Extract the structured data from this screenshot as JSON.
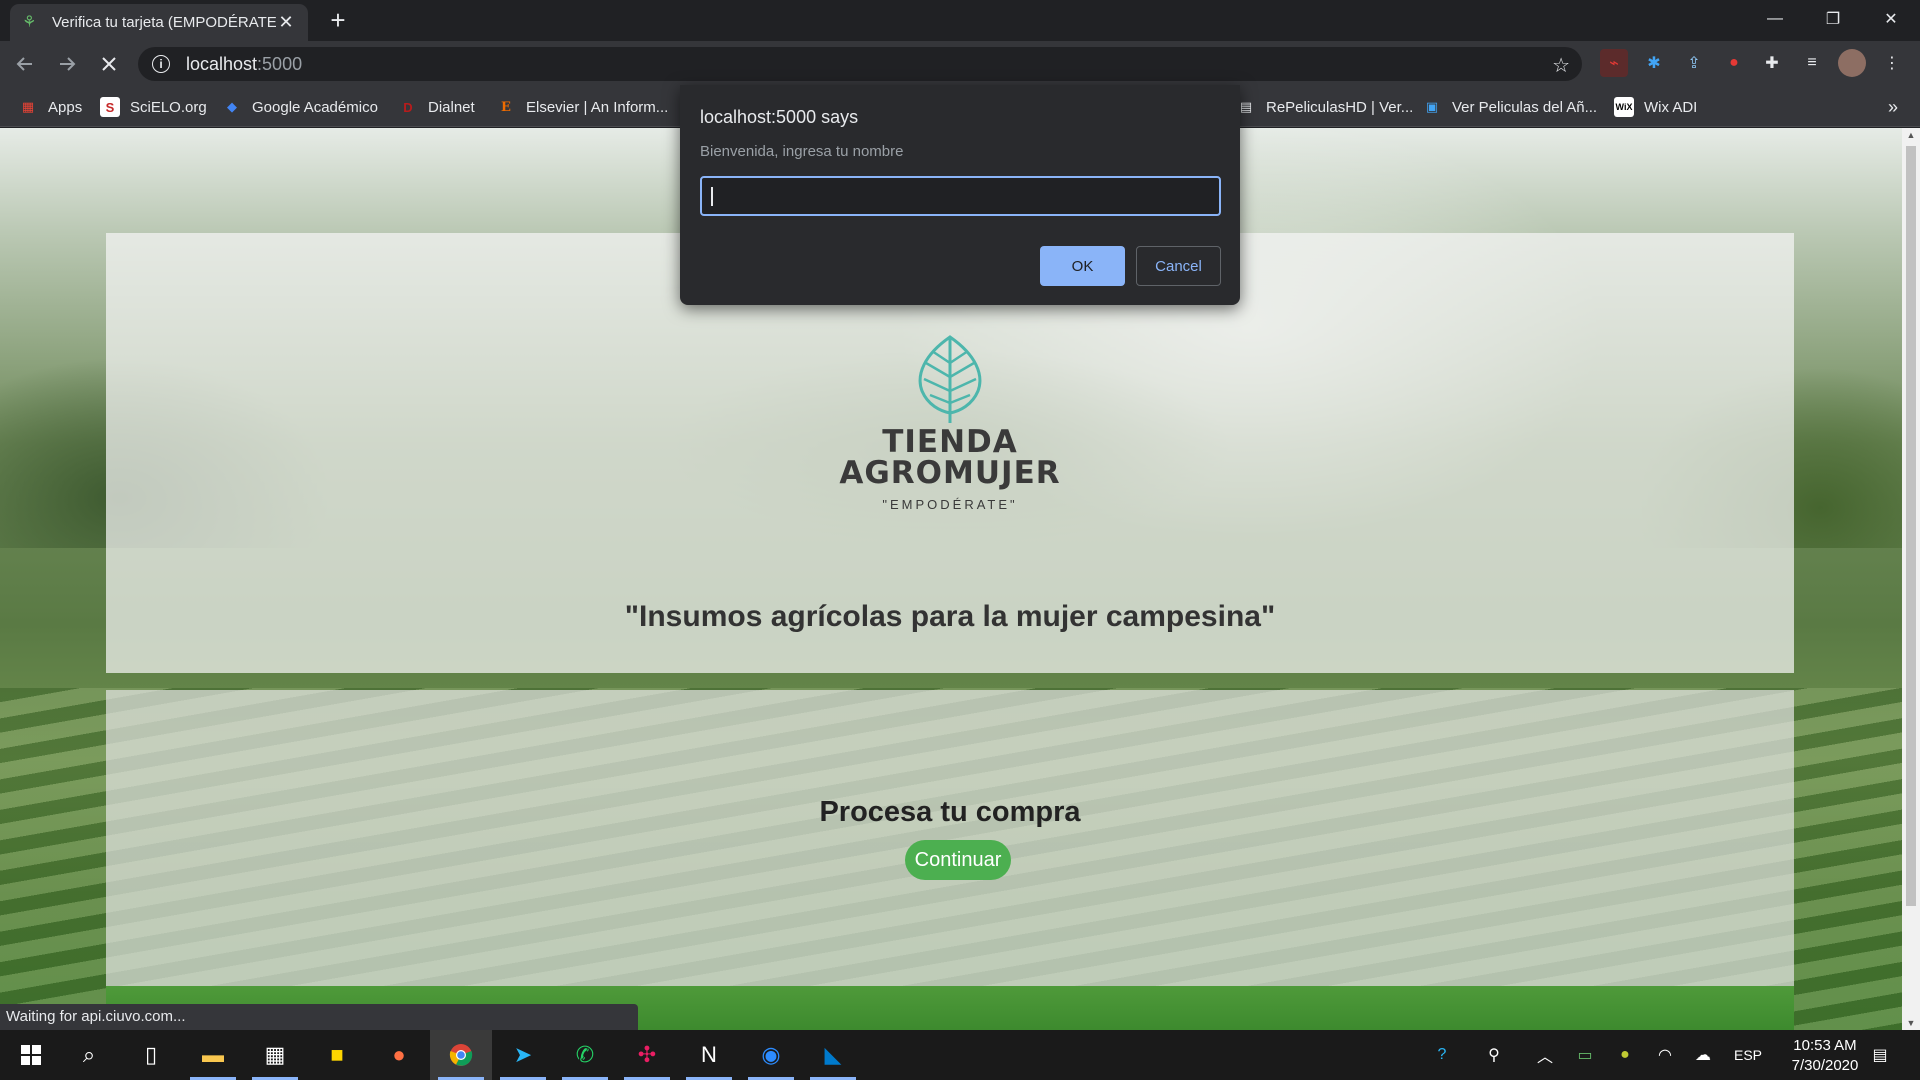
{
  "browser": {
    "tab_title": "Verifica tu tarjeta (EMPODÉRATE)",
    "tab_close": "✕",
    "new_tab": "+",
    "url_host": "localhost",
    "url_port": ":5000",
    "window_controls": {
      "minimize": "—",
      "restore": "❐",
      "close": "✕"
    },
    "bookmarks": [
      {
        "label": "Apps",
        "icon": "apps-grid-icon",
        "color": "#ea4335"
      },
      {
        "label": "SciELO.org",
        "icon": "scielo-icon",
        "color": "#c62828"
      },
      {
        "label": "Google Académico",
        "icon": "google-scholar-icon",
        "color": "#4285f4"
      },
      {
        "label": "Dialnet",
        "icon": "dialnet-icon",
        "color": "#b71c1c"
      },
      {
        "label": "Elsevier | An Inform...",
        "icon": "elsevier-icon",
        "color": "#ef6c00"
      },
      {
        "label": "RePeliculasHD | Ver...",
        "icon": "repeliculas-icon",
        "color": "#e8eaed"
      },
      {
        "label": "Ver Peliculas del Añ...",
        "icon": "peliculas-icon",
        "color": "#42a5f5"
      },
      {
        "label": "Wix ADI",
        "icon": "wix-icon",
        "color": "#ffffff"
      }
    ],
    "status_text": "Waiting for api.ciuvo.com..."
  },
  "dialog": {
    "title": "localhost:5000 says",
    "message": "Bienvenida, ingresa tu nombre",
    "input_value": "",
    "ok_label": "OK",
    "cancel_label": "Cancel"
  },
  "page": {
    "brand_line1": "TIENDA",
    "brand_line2": "AGROMUJER",
    "slogan": "\"EMPODÉRATE\"",
    "tagline": "\"Insumos agrícolas para la mujer campesina\"",
    "process_title": "Procesa tu compra",
    "continue_label": "Continuar",
    "accent_color": "#4caf50",
    "logo_color": "#4db6ac"
  },
  "taskbar": {
    "language": "ESP",
    "time": "10:53 AM",
    "date": "7/30/2020"
  }
}
